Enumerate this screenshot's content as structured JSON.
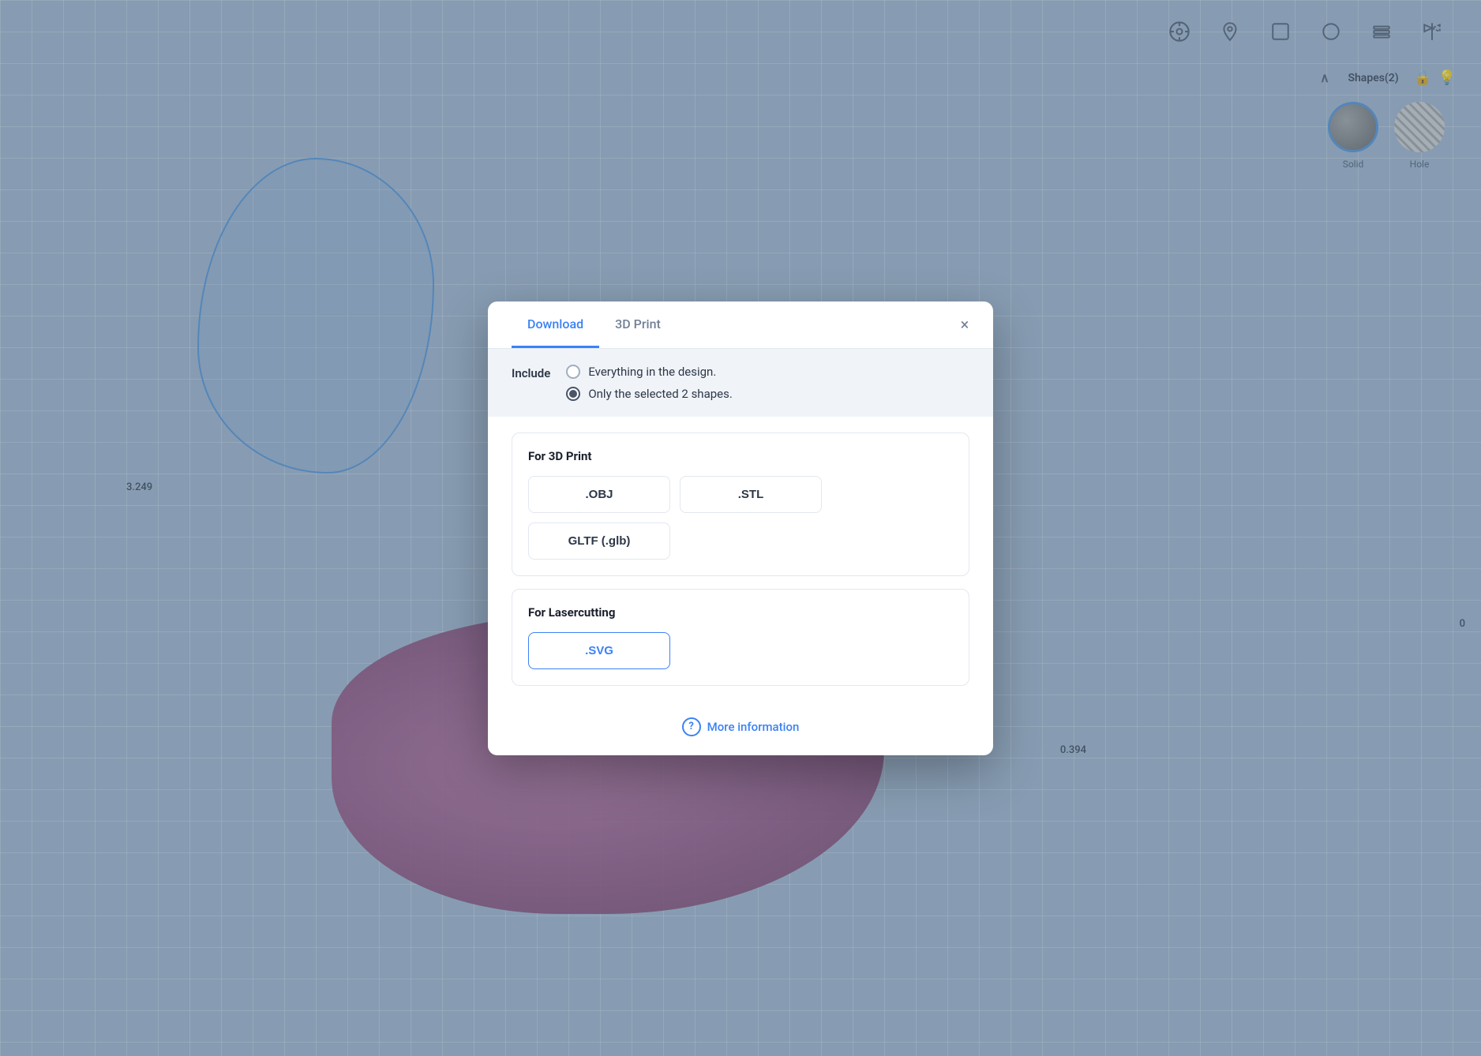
{
  "canvas": {
    "measurement_left": "3.249",
    "measurement_right": "0.394",
    "measurement_far_right": "0"
  },
  "toolbar": {
    "icons": [
      {
        "name": "comment-icon",
        "symbol": "💬"
      },
      {
        "name": "location-icon",
        "symbol": "📍"
      },
      {
        "name": "shape-icon",
        "symbol": "⬜"
      },
      {
        "name": "circle-icon",
        "symbol": "⭕"
      },
      {
        "name": "layers-icon",
        "symbol": "⊟"
      },
      {
        "name": "mirror-icon",
        "symbol": "◧"
      }
    ]
  },
  "right_panel": {
    "shapes_title": "Shapes(2)",
    "solid_label": "Solid",
    "hole_label": "Hole"
  },
  "modal": {
    "tab_download": "Download",
    "tab_3d_print": "3D Print",
    "close_symbol": "×",
    "include_label": "Include",
    "option_everything": "Everything in the design.",
    "option_selected": "Only the selected 2 shapes.",
    "for_3d_print_title": "For 3D Print",
    "btn_obj": ".OBJ",
    "btn_stl": ".STL",
    "btn_gltf": "GLTF (.glb)",
    "for_lasercutting_title": "For Lasercutting",
    "btn_svg": ".SVG",
    "more_info_icon": "?",
    "more_info_text": "More information"
  }
}
